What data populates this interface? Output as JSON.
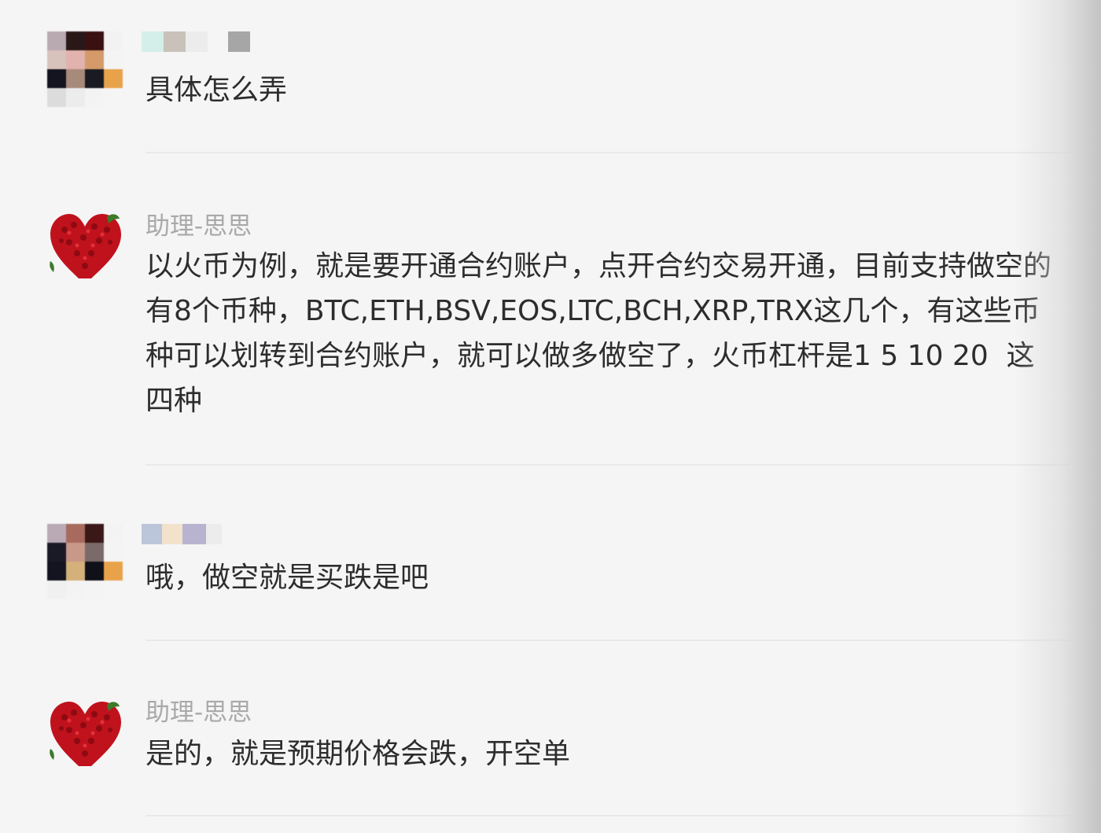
{
  "messages": [
    {
      "sender": "",
      "text": "具体怎么弄"
    },
    {
      "sender": "助理-思思",
      "text": "以火币为例，就是要开通合约账户，点开合约交易开通，目前支持做空的有8个币种，BTC,ETH,BSV,EOS,LTC,BCH,XRP,TRX这几个，有这些币种可以划转到合约账户，就可以做多做空了，火币杠杆是1 5 10 20  这四种"
    },
    {
      "sender": "",
      "text": "哦，做空就是买跌是吧"
    },
    {
      "sender": "助理-思思",
      "text": "是的，就是预期价格会跌，开空单"
    }
  ],
  "colors": {
    "background": "#f5f5f5",
    "text": "#2d2d2d",
    "sender": "#a9a9a9",
    "heart": "#c0121c"
  }
}
